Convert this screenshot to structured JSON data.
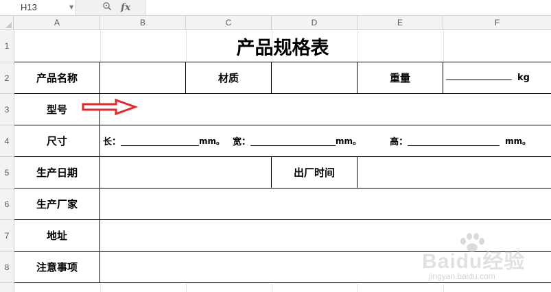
{
  "formula_bar": {
    "cell_ref": "H13",
    "fx_label": "fx",
    "formula": ""
  },
  "columns": [
    "A",
    "B",
    "C",
    "D",
    "E",
    "F"
  ],
  "rows": [
    "1",
    "2",
    "3",
    "4",
    "5",
    "6",
    "7",
    "8"
  ],
  "sheet": {
    "title": "产品规格表",
    "product_name_label": "产品名称",
    "material_label": "材质",
    "weight_label": "重量",
    "weight_unit": "kg",
    "model_label": "型号",
    "size_label": "尺寸",
    "length_label": "长：",
    "width_label": "宽：",
    "height_label": "高：",
    "mm_unit": "mm。",
    "production_date_label": "生产日期",
    "factory_time_label": "出厂时间",
    "manufacturer_label": "生产厂家",
    "address_label": "地址",
    "notes_label": "注意事项"
  },
  "watermark": {
    "brand": "Baidu经验",
    "url": "jingyan.baidu.com"
  },
  "colors": {
    "arrow": "#e8262a",
    "header_bg": "#f3f3f3",
    "grid_line": "#e2e2e2"
  }
}
